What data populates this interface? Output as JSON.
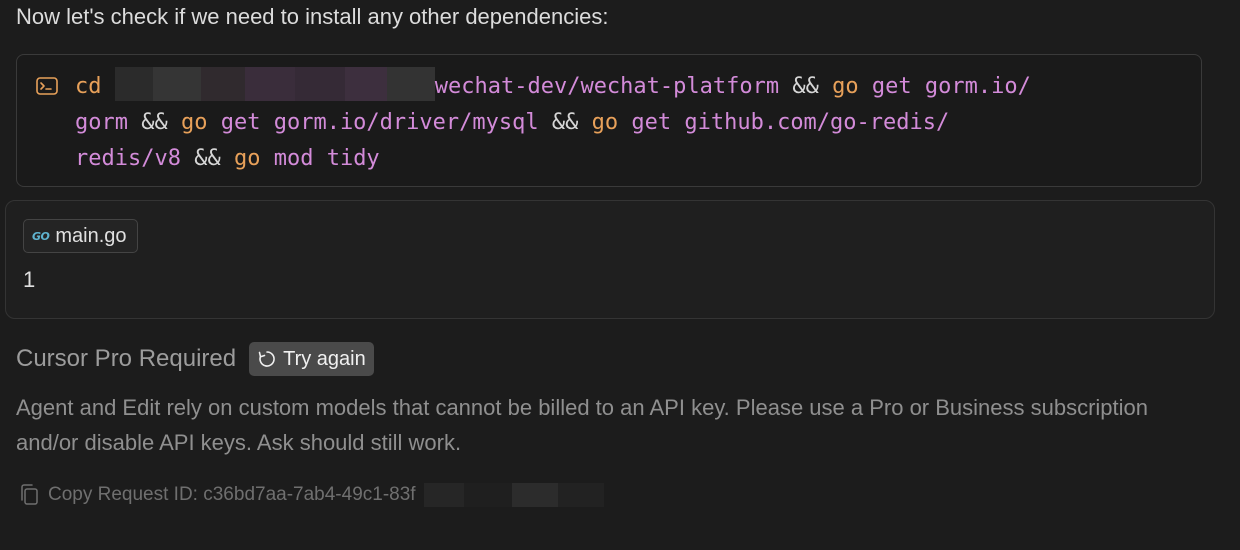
{
  "intro": "Now let's check if we need to install any other dependencies:",
  "terminal": {
    "icon": "terminal-icon",
    "cmd_cd": "cd",
    "cd_path_tail": "wechat-dev/wechat-platform",
    "amp1": "&&",
    "go1": "go",
    "get1": "get gorm.io/",
    "line2_a": "gorm",
    "amp2": "&&",
    "go2": "go",
    "get2": "get gorm.io/driver/mysql",
    "amp3": "&&",
    "go3": "go",
    "get3": "get github.com/go-redis/",
    "line3_a": "redis/v8",
    "amp4": "&&",
    "go4": "go",
    "mod": "mod tidy"
  },
  "context": {
    "file_icon": "go-file-icon",
    "file_icon_text": "GO",
    "file_name": "main.go",
    "value": "1"
  },
  "error": {
    "title": "Cursor Pro Required",
    "retry_label": "Try again",
    "message": "Agent and Edit rely on custom models that cannot be billed to an API key. Please use a Pro or Business subscription and/or disable API keys. Ask should still work.",
    "copy_label": "Copy Request ID: c36bd7aa-7ab4-49c1-83f"
  },
  "colors": {
    "background": "#1c1c1c",
    "keyword": "#e8a15a",
    "argument": "#d38bd9",
    "retry_button": "#4a4a4a"
  }
}
